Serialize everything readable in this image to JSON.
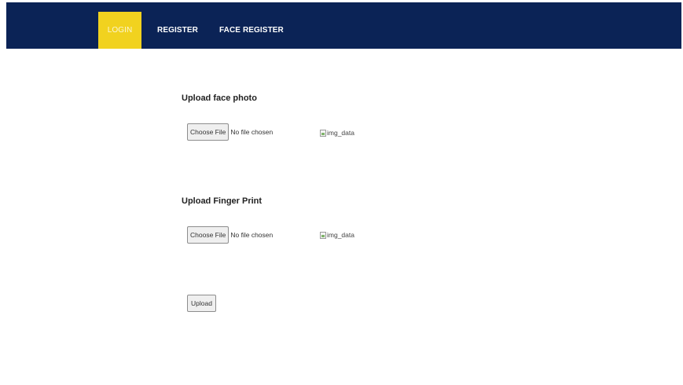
{
  "nav": {
    "items": [
      {
        "label": "LOGIN",
        "active": true
      },
      {
        "label": "REGISTER",
        "active": false
      },
      {
        "label": "FACE REGISTER",
        "active": false
      }
    ]
  },
  "face_section": {
    "title": "Upload face photo",
    "choose_label": "Choose File",
    "file_status": "No file chosen",
    "image_alt": "img_data"
  },
  "finger_section": {
    "title": "Upload Finger Print",
    "choose_label": "Choose File",
    "file_status": "No file chosen",
    "image_alt": "img_data"
  },
  "form": {
    "upload_label": "Upload"
  },
  "colors": {
    "navbar": "#0b2356",
    "active_tab": "#f1d21f"
  },
  "icons": {
    "broken_image": "broken-image-icon"
  }
}
